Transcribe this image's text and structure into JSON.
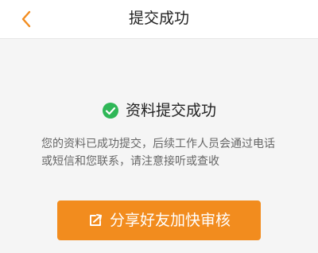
{
  "nav": {
    "title": "提交成功",
    "back_icon": "chevron-left-icon"
  },
  "status": {
    "icon": "check-circle-icon",
    "title": "资料提交成功",
    "description": "您的资料已成功提交，后续工作人员会通过电话或短信和您联系，请注意接听或查收"
  },
  "share_button": {
    "icon": "share-icon",
    "label": "分享好友加快审核"
  },
  "colors": {
    "accent": "#f28c1e",
    "success": "#2fb757",
    "background": "#f5f5f5",
    "header_background": "#ffffff",
    "title_text": "#222222",
    "body_text": "#666666"
  }
}
